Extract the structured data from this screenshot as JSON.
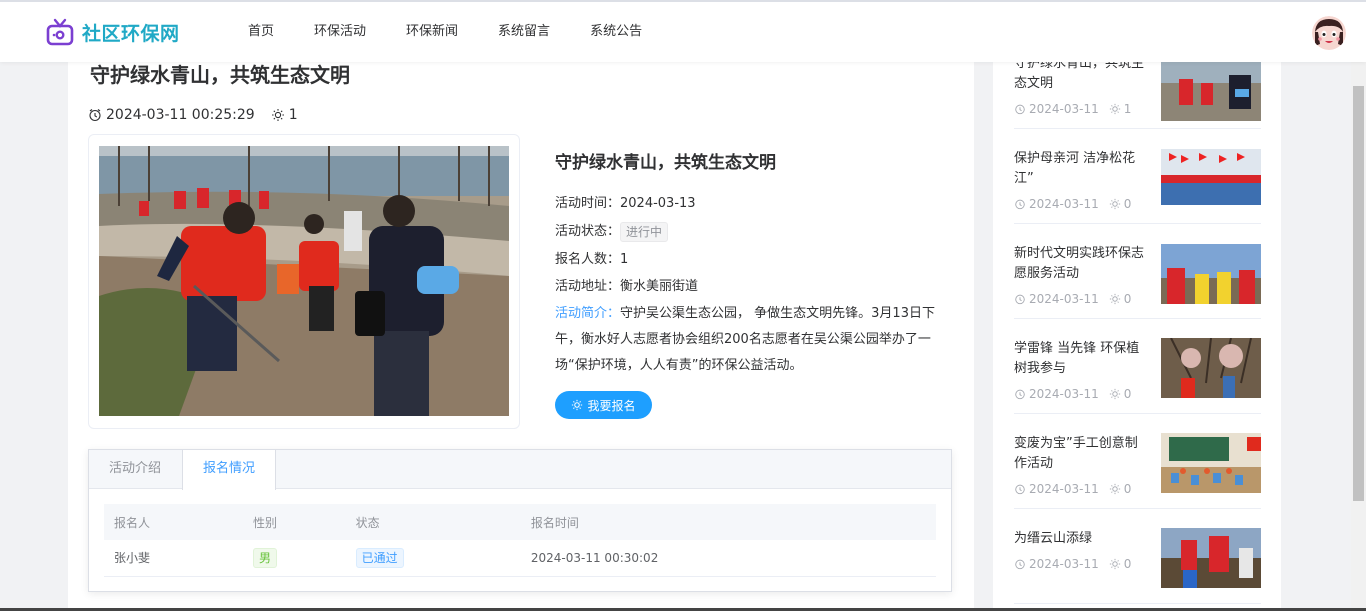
{
  "header": {
    "site_name": "社区环保网",
    "nav": [
      "首页",
      "环保活动",
      "环保新闻",
      "系统留言",
      "系统公告"
    ]
  },
  "article": {
    "title": "守护绿水青山，共筑生态文明",
    "datetime": "2024-03-11 00:25:29",
    "views": "1"
  },
  "activity": {
    "title": "守护绿水青山，共筑生态文明",
    "time_label": "活动时间：",
    "time": "2024-03-13",
    "status_label": "活动状态：",
    "status": "进行中",
    "count_label": "报名人数：",
    "count": "1",
    "address_label": "活动地址：",
    "address": "衡水美丽街道",
    "intro_label": "活动简介：",
    "intro": "守护吴公渠生态公园， 争做生态文明先锋。3月13日下午，衡水好人志愿者协会组织200名志愿者在吴公渠公园举办了一场“保护环境，人人有责”的环保公益活动。",
    "signup_button": "我要报名"
  },
  "tabs": [
    "活动介绍",
    "报名情况"
  ],
  "signup_table": {
    "headers": [
      "报名人",
      "性别",
      "状态",
      "报名时间"
    ],
    "rows": [
      {
        "name": "张小斐",
        "gender": "男",
        "status": "已通过",
        "time": "2024-03-11 00:30:02"
      }
    ]
  },
  "sidebar": {
    "items": [
      {
        "title": "守护绿水青山，共筑生态文明",
        "date": "2024-03-11",
        "views": "1"
      },
      {
        "title": "保护母亲河 洁净松花江”",
        "date": "2024-03-11",
        "views": "0"
      },
      {
        "title": "新时代文明实践环保志愿服务活动",
        "date": "2024-03-11",
        "views": "0"
      },
      {
        "title": "学雷锋 当先锋 环保植树我参与",
        "date": "2024-03-11",
        "views": "0"
      },
      {
        "title": "变废为宝”手工创意制作活动",
        "date": "2024-03-11",
        "views": "0"
      },
      {
        "title": "为缙云山添绿",
        "date": "2024-03-11",
        "views": "0"
      }
    ]
  },
  "colors": {
    "brand": "#20a9c6",
    "primary": "#1e9fff",
    "link": "#409eff"
  }
}
